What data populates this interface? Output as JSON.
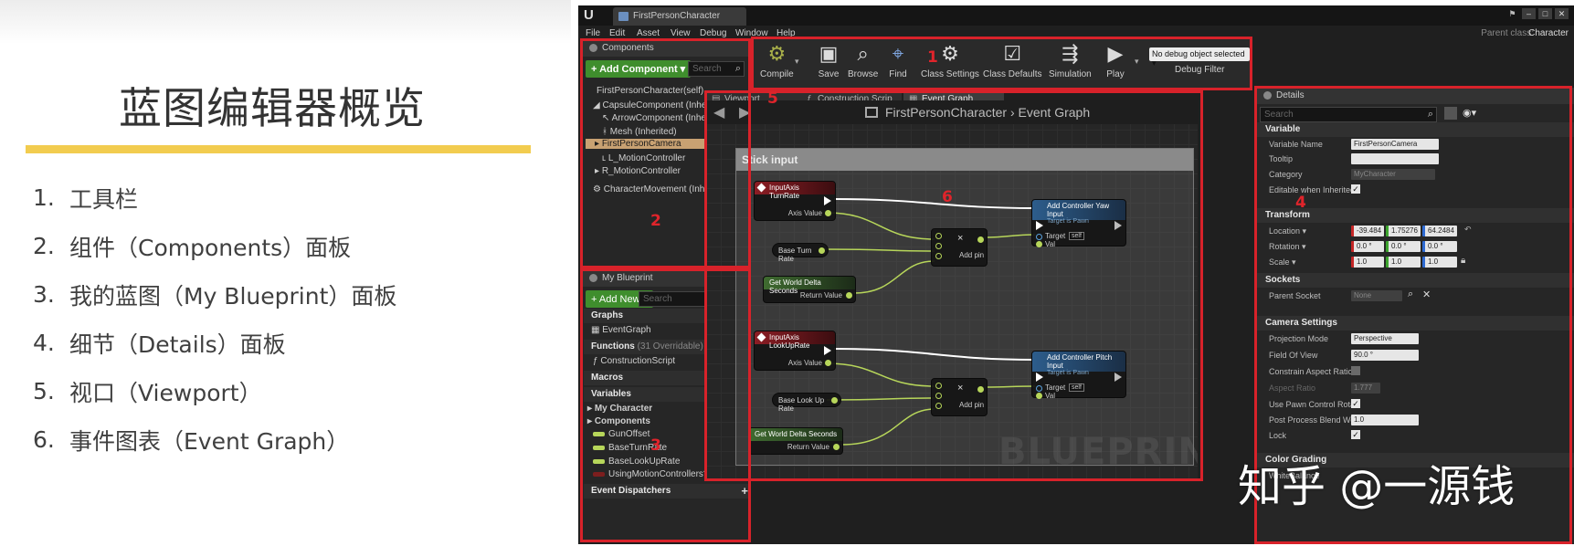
{
  "slide": {
    "title": "蓝图编辑器概览",
    "items": [
      {
        "num": "1.",
        "text": "工具栏"
      },
      {
        "num": "2.",
        "text": "组件（Components）面板"
      },
      {
        "num": "3.",
        "text": "我的蓝图（My Blueprint）面板"
      },
      {
        "num": "4.",
        "text": "细节（Details）面板"
      },
      {
        "num": "5.",
        "text": "视口（Viewport）"
      },
      {
        "num": "6.",
        "text": "事件图表（Event Graph）"
      }
    ]
  },
  "editor": {
    "tab_title": "FirstPersonCharacter",
    "menu": [
      "File",
      "Edit",
      "Asset",
      "View",
      "Debug",
      "Window",
      "Help"
    ],
    "parent_class_label": "Parent class:",
    "parent_class_value": "Character",
    "annotations": [
      "1",
      "2",
      "3",
      "4",
      "5",
      "6"
    ]
  },
  "components": {
    "header": "Components",
    "add_button": "+ Add Component ▾",
    "search_placeholder": "Search",
    "items": [
      "FirstPersonCharacter(self)",
      "CapsuleComponent (Inherited)",
      "ArrowComponent (Inherited)",
      "Mesh (Inherited)",
      "FirstPersonCamera",
      "L_MotionController",
      "R_MotionController",
      "CharacterMovement (Inherited)"
    ]
  },
  "my_blueprint": {
    "header": "My Blueprint",
    "add_button": "+ Add New ▾",
    "search_placeholder": "Search",
    "graphs_label": "Graphs",
    "event_graph": "EventGraph",
    "functions_label": "Functions",
    "functions_note": "(31 Overridable)",
    "construction_script": "ConstructionScript",
    "macros_label": "Macros",
    "variables_label": "Variables",
    "my_character": "My Character",
    "components_label": "Components",
    "variables": [
      "GunOffset",
      "BaseTurnRate",
      "BaseLookUpRate",
      "UsingMotionControllers?"
    ],
    "event_dispatchers": "Event Dispatchers"
  },
  "toolbar": {
    "buttons": [
      "Compile",
      "Save",
      "Browse",
      "Find",
      "Class Settings",
      "Class Defaults",
      "Simulation",
      "Play"
    ],
    "debug_object": "No debug object selected ▾",
    "debug_filter": "Debug Filter"
  },
  "graph_tabs": [
    "Viewport",
    "Construction Scrip",
    "Event Graph"
  ],
  "graph": {
    "breadcrumb_root": "FirstPersonCharacter",
    "breadcrumb_sep": "›",
    "breadcrumb_leaf": "Event Graph",
    "comment_title": "Stick input",
    "watermark": "BLUEPRINT",
    "nodes": {
      "turn_rate": "InputAxis TurnRate",
      "look_up_rate": "InputAxis LookUpRate",
      "axis_value": "Axis Value",
      "base_turn_rate": "Base Turn Rate",
      "base_look_up_rate": "Base Look Up Rate",
      "world_delta": "Get World Delta Seconds",
      "return_value": "Return Value",
      "add_pin": "Add pin",
      "multiply": "×",
      "yaw_input": "Add Controller Yaw Input",
      "pitch_input": "Add Controller Pitch Input",
      "target_is": "Target is Pawn",
      "target": "Target",
      "self": "self",
      "val": "Val"
    }
  },
  "details": {
    "header": "Details",
    "search_placeholder": "Search",
    "variable_section": "Variable",
    "variable_name_label": "Variable Name",
    "variable_name_value": "FirstPersonCamera",
    "tooltip_label": "Tooltip",
    "category_label": "Category",
    "category_value": "MyCharacter",
    "editable_label": "Editable when Inherited",
    "transform_section": "Transform",
    "location_label": "Location ▾",
    "location": [
      "-39.484",
      "1.75276",
      "64.2484"
    ],
    "rotation_label": "Rotation ▾",
    "rotation": [
      "0.0 °",
      "0.0 °",
      "0.0 °"
    ],
    "scale_label": "Scale ▾",
    "scale": [
      "1.0",
      "1.0",
      "1.0"
    ],
    "sockets_section": "Sockets",
    "parent_socket_label": "Parent Socket",
    "parent_socket_value": "None",
    "camera_section": "Camera Settings",
    "projection_label": "Projection Mode",
    "projection_value": "Perspective",
    "fov_label": "Field Of View",
    "fov_value": "90.0 °",
    "aspect_constrain_label": "Constrain Aspect Ratio",
    "aspect_ratio_label": "Aspect Ratio",
    "aspect_ratio_value": "1.777",
    "use_pawn_label": "Use Pawn Control Rotat",
    "post_process_label": "Post Process Blend Wei",
    "post_process_value": "1.0",
    "lock_label": "Lock",
    "color_grading_section": "Color Grading",
    "white_balance": "WhiteBalance"
  },
  "watermark": "知乎 @一源钱",
  "colors": {
    "annotation": "#d8222a",
    "accent_bar": "#f2cc4f",
    "add_green": "#3f8e2d"
  }
}
